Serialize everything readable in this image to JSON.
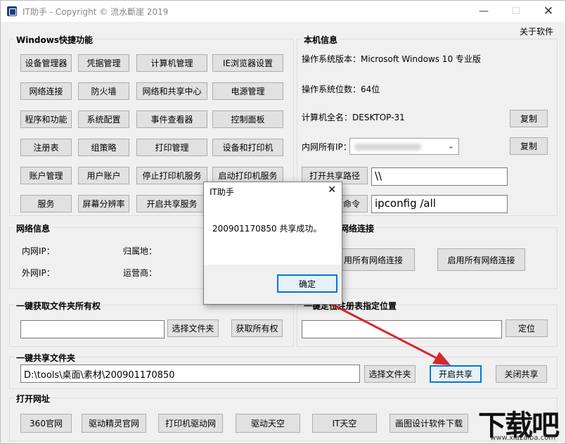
{
  "window": {
    "title": "IT助手 - Copyright © 流水斷崖 2019",
    "about": "关于软件"
  },
  "win_shortcuts": {
    "label": "Windows快捷功能",
    "buttons": [
      "设备管理器",
      "凭据管理",
      "计算机管理",
      "IE浏览器设置",
      "网络连接",
      "防火墙",
      "网络和共享中心",
      "电源管理",
      "程序和功能",
      "系统配置",
      "事件查看器",
      "控制面板",
      "注册表",
      "组策略",
      "打印管理",
      "设备和打印机",
      "账户管理",
      "用户账户",
      "停止打印机服务",
      "启动打印机服务",
      "服务",
      "屏幕分辨率",
      "开启共享服务"
    ]
  },
  "local_info": {
    "label": "本机信息",
    "os_version": "操作系统版本：Microsoft Windows 10 专业版",
    "os_bits": "操作系统位数：64位",
    "computer_name": "计算机全名：DESKTOP-31",
    "copy_btn": "复制",
    "lan_ip_label": "内网所有IP：",
    "open_share_path": "打开共享路径",
    "share_path_value": "\\\\",
    "cmd_btn_partial": "命令",
    "cmd_value": "ipconfig /all"
  },
  "net_info": {
    "label": "网络信息",
    "lan_ip": "内网IP：",
    "wan_ip": "外网IP：",
    "location": "归属地：",
    "isp": "运营商："
  },
  "net_conn": {
    "label_partial": "网络连接",
    "disable_all_partial": "用所有网络连接",
    "enable_all": "启用所有网络连接"
  },
  "folder_owner": {
    "label": "一键获取文件夹所有权",
    "select_btn": "选择文件夹",
    "get_btn": "获取所有权",
    "path_value": ""
  },
  "registry": {
    "label": "一键定位注册表指定位置",
    "locate_btn": "定位",
    "path_value": ""
  },
  "share_folder": {
    "label": "一键共享文件夹",
    "path_value": "D:\\tools\\桌面\\素材\\200901170850",
    "select_btn": "选择文件夹",
    "start_btn": "开启共享",
    "stop_btn": "关闭共享"
  },
  "open_url": {
    "label": "打开网址",
    "buttons": [
      "360官网",
      "驱动精灵官网",
      "打印机驱动网",
      "驱动天空",
      "IT天空",
      "画图设计软件下载"
    ]
  },
  "dialog": {
    "title": "IT助手",
    "message": "200901170850 共享成功。",
    "ok": "确定"
  },
  "watermark": {
    "logo": "下载吧",
    "url": "www.xiazaiba.com"
  },
  "colors": {
    "accent": "#0078d7",
    "arrow": "#d9262b",
    "window_bg": "#f0f0f0"
  }
}
